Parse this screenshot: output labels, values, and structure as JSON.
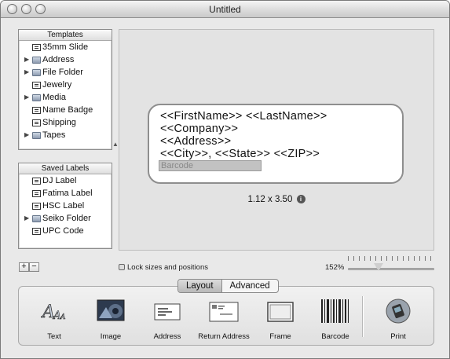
{
  "window": {
    "title": "Untitled"
  },
  "templates": {
    "header": "Templates",
    "items": [
      {
        "label": "35mm Slide",
        "type": "label"
      },
      {
        "label": "Address",
        "type": "folder"
      },
      {
        "label": "File Folder",
        "type": "folder"
      },
      {
        "label": "Jewelry",
        "type": "label"
      },
      {
        "label": "Media",
        "type": "folder"
      },
      {
        "label": "Name Badge",
        "type": "label"
      },
      {
        "label": "Shipping",
        "type": "label"
      },
      {
        "label": "Tapes",
        "type": "folder"
      }
    ]
  },
  "saved_labels": {
    "header": "Saved Labels",
    "items": [
      {
        "label": "DJ Label",
        "type": "label"
      },
      {
        "label": "Fatima Label",
        "type": "label"
      },
      {
        "label": "HSC Label",
        "type": "label"
      },
      {
        "label": "Seiko Folder",
        "type": "folder"
      },
      {
        "label": "UPC Code",
        "type": "label"
      }
    ]
  },
  "label_preview": {
    "lines": [
      "<<FirstName>> <<LastName>>",
      "<<Company>>",
      "<<Address>>",
      "<<City>>, <<State>> <<ZIP>>"
    ],
    "barcode": "Barcode",
    "size": "1.12 x 3.50"
  },
  "list_controls": {
    "add": "+",
    "remove": "−"
  },
  "lock_label": "Lock sizes and positions",
  "zoom": {
    "text": "152%",
    "level": 0.35
  },
  "tabs": [
    "Layout",
    "Advanced"
  ],
  "tools": [
    "Text",
    "Image",
    "Address",
    "Return Address",
    "Frame",
    "Barcode",
    "Print"
  ]
}
